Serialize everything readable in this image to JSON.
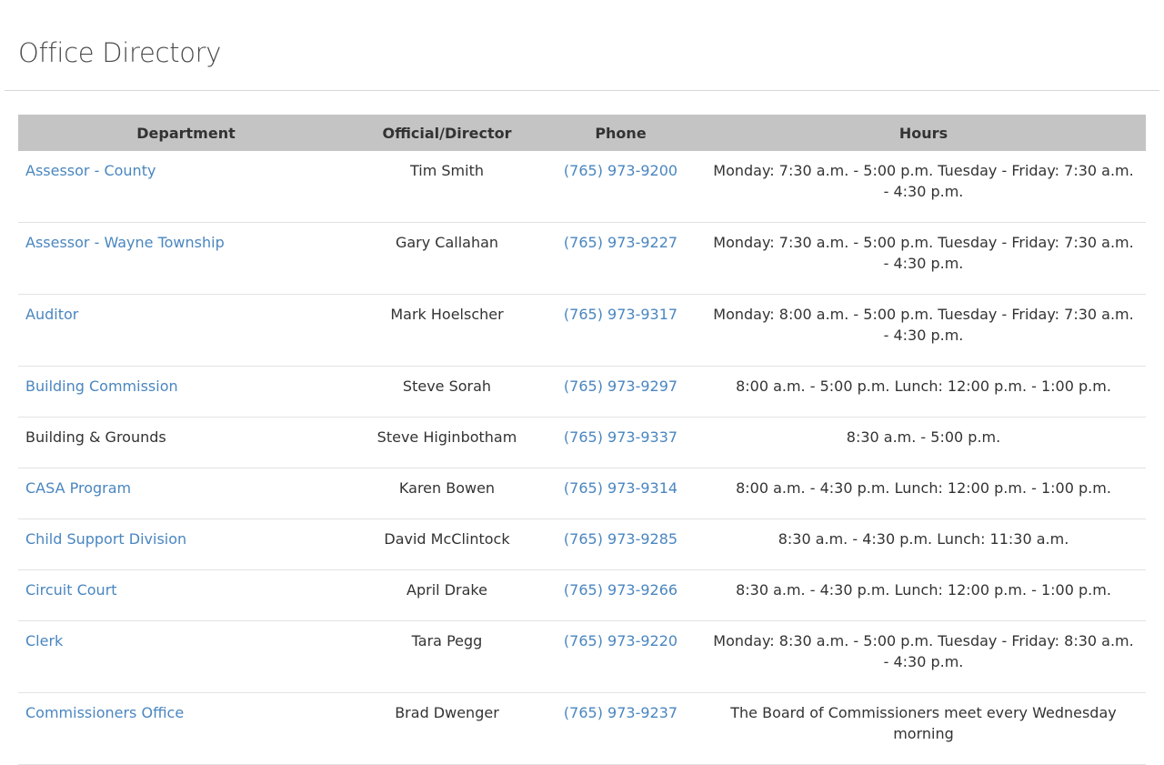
{
  "page": {
    "title": "Office Directory"
  },
  "table": {
    "headers": [
      "Department",
      "Official/Director",
      "Phone",
      "Hours"
    ],
    "rows": [
      {
        "department": "Assessor - County",
        "dept_link": true,
        "official": "Tim Smith",
        "phone": "(765) 973-9200",
        "hours": "Monday: 7:30 a.m. - 5:00 p.m. Tuesday - Friday: 7:30 a.m. - 4:30 p.m."
      },
      {
        "department": "Assessor - Wayne Township",
        "dept_link": true,
        "official": "Gary Callahan",
        "phone": "(765) 973-9227",
        "hours": "Monday: 7:30 a.m. - 5:00 p.m. Tuesday - Friday: 7:30 a.m. - 4:30 p.m."
      },
      {
        "department": "Auditor",
        "dept_link": true,
        "official": "Mark Hoelscher",
        "phone": "(765) 973-9317",
        "hours": "Monday: 8:00 a.m. - 5:00 p.m. Tuesday - Friday: 7:30 a.m. - 4:30 p.m."
      },
      {
        "department": "Building Commission",
        "dept_link": true,
        "official": "Steve Sorah",
        "phone": "(765) 973-9297",
        "hours": "8:00 a.m. - 5:00 p.m. Lunch: 12:00 p.m. - 1:00 p.m."
      },
      {
        "department": "Building & Grounds",
        "dept_link": false,
        "official": "Steve Higinbotham",
        "phone": "(765) 973-9337",
        "hours": "8:30 a.m. - 5:00 p.m."
      },
      {
        "department": "CASA Program",
        "dept_link": true,
        "official": "Karen Bowen",
        "phone": "(765) 973-9314",
        "hours": "8:00 a.m. - 4:30 p.m. Lunch: 12:00 p.m. - 1:00 p.m."
      },
      {
        "department": "Child Support Division",
        "dept_link": true,
        "official": "David McClintock",
        "phone": "(765) 973-9285",
        "hours": "8:30 a.m. - 4:30 p.m. Lunch: 11:30 a.m."
      },
      {
        "department": "Circuit Court",
        "dept_link": true,
        "official": "April Drake",
        "phone": "(765) 973-9266",
        "hours": "8:30 a.m. - 4:30 p.m. Lunch: 12:00 p.m. - 1:00 p.m."
      },
      {
        "department": "Clerk",
        "dept_link": true,
        "official": "Tara Pegg",
        "phone": "(765) 973-9220",
        "hours": "Monday: 8:30 a.m. - 5:00 p.m. Tuesday - Friday: 8:30 a.m. - 4:30 p.m."
      },
      {
        "department": "Commissioners Office",
        "dept_link": true,
        "official": "Brad Dwenger",
        "phone": "(765) 973-9237",
        "hours": "The Board of Commissioners meet every Wednesday morning"
      }
    ]
  },
  "colors": {
    "link": "#4a86c0",
    "header_bg": "#c4c4c4",
    "text": "#333333"
  }
}
